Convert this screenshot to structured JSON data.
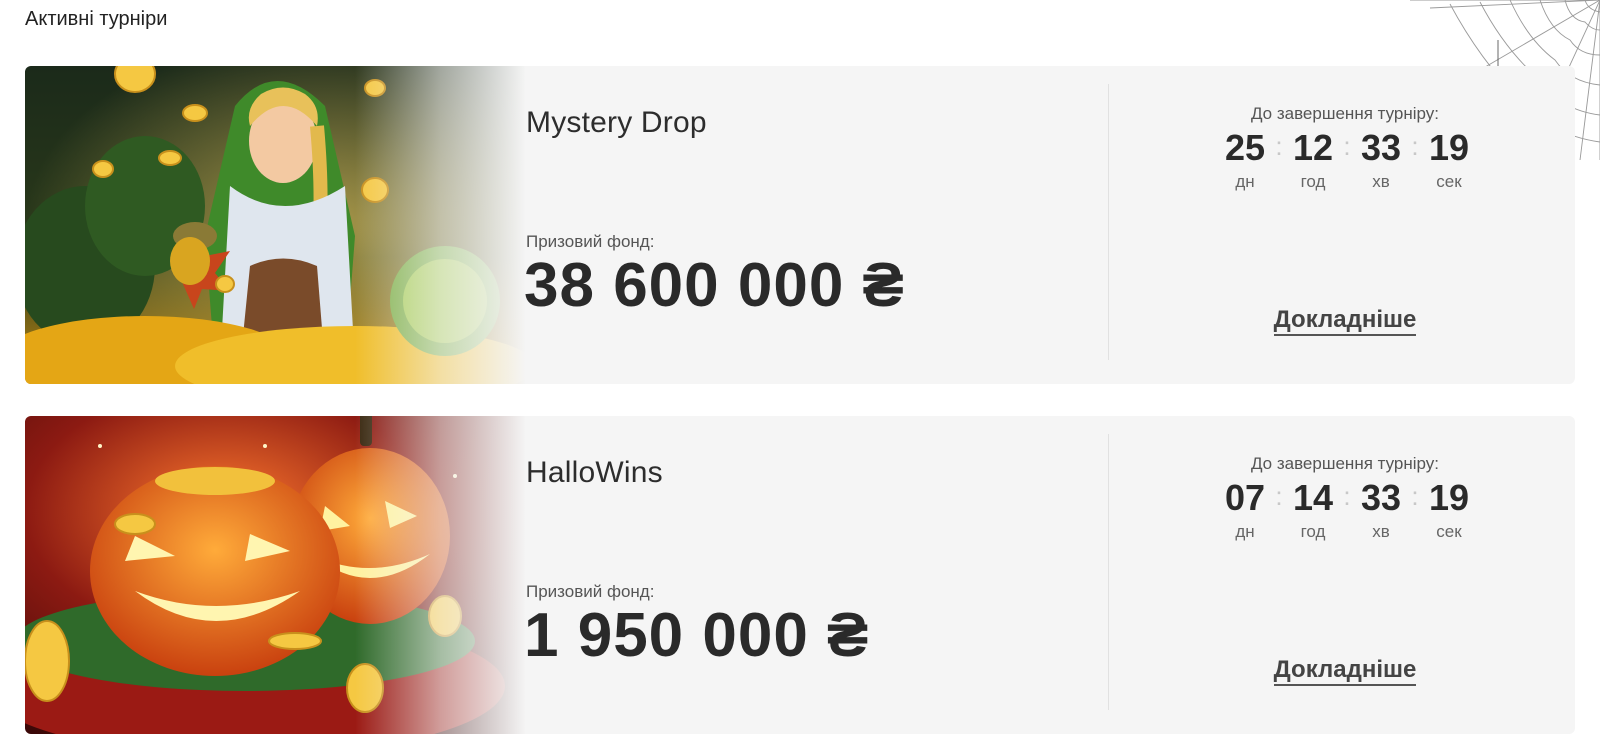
{
  "page": {
    "section_title": "Активні турніри"
  },
  "tournaments": [
    {
      "name": "Mystery Drop",
      "prize_label": "Призовий фонд:",
      "prize_value": "38 600 000 ₴",
      "timer_title": "До завершення турніру:",
      "timer": [
        {
          "value": "25",
          "unit": "дн"
        },
        {
          "value": "12",
          "unit": "год"
        },
        {
          "value": "33",
          "unit": "хв"
        },
        {
          "value": "19",
          "unit": "сек"
        }
      ],
      "details_label": "Докладніше",
      "banner_icon": "forest-maiden-banner"
    },
    {
      "name": "HalloWins",
      "prize_label": "Призовий фонд:",
      "prize_value": "1 950 000 ₴",
      "timer_title": "До завершення турніру:",
      "timer": [
        {
          "value": "07",
          "unit": "дн"
        },
        {
          "value": "14",
          "unit": "год"
        },
        {
          "value": "33",
          "unit": "хв"
        },
        {
          "value": "19",
          "unit": "сек"
        }
      ],
      "details_label": "Докладніше",
      "banner_icon": "pumpkins-banner"
    }
  ],
  "decoration": {
    "corner_icon": "spider-web-icon"
  }
}
